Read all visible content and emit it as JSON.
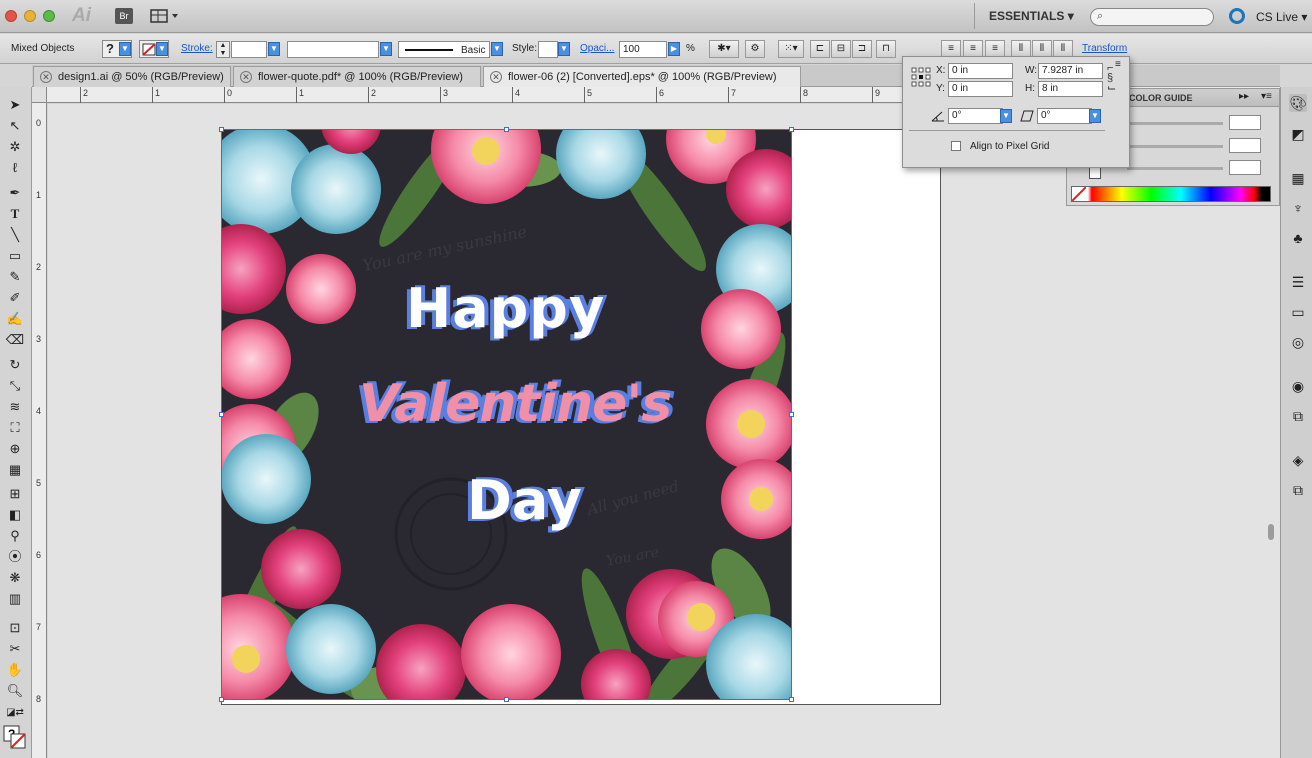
{
  "app": {
    "logo": "Ai",
    "bridge": "Br",
    "workspace": "ESSENTIALS",
    "search_placeholder": "",
    "cslive": "CS Live"
  },
  "control": {
    "selection": "Mixed Objects",
    "stroke_label": "Stroke:",
    "brush": "Basic",
    "style_label": "Style:",
    "opacity_label": "Opaci...",
    "opacity_value": "100",
    "opacity_unit": "%",
    "transform_link": "Transform"
  },
  "tabs": [
    {
      "label": "design1.ai @ 50% (RGB/Preview)"
    },
    {
      "label": "flower-quote.pdf* @ 100% (RGB/Preview)"
    },
    {
      "label": "flower-06 (2) [Converted].eps* @ 100% (RGB/Preview)"
    }
  ],
  "ruler_h": [
    "2",
    "1",
    "0",
    "1",
    "2",
    "3",
    "4",
    "5",
    "6",
    "7",
    "8",
    "9"
  ],
  "ruler_v": [
    "0",
    "1",
    "2",
    "3",
    "4",
    "5",
    "6",
    "7",
    "8"
  ],
  "transform_panel": {
    "x_label": "X:",
    "x_value": "0 in",
    "y_label": "Y:",
    "y_value": "0 in",
    "w_label": "W:",
    "w_value": "7.9287 in",
    "h_label": "H:",
    "h_value": "8 in",
    "rotate_value": "0°",
    "shear_value": "0°",
    "pixel_grid": "Align to Pixel Grid"
  },
  "color_panel": {
    "title": "COLOR GUIDE"
  },
  "artwork": {
    "line1": "Happy",
    "line2": "Valentine's",
    "line3": "Day",
    "script1": "You are my sunshine",
    "script2": "All you need",
    "script3": "You are"
  }
}
